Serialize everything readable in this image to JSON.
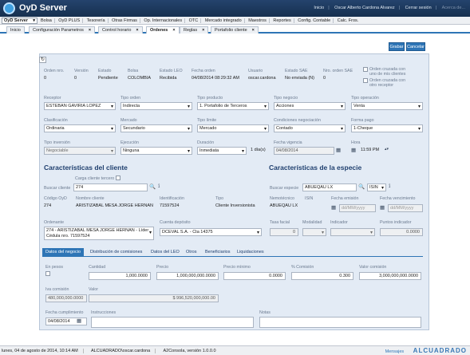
{
  "app": {
    "title": "OyD Server"
  },
  "user_links": [
    "Inicio",
    "Oscar Alberto Cardona Alvarez",
    "Cerrar sesión",
    "Acerca de..."
  ],
  "menu": {
    "selector": "OyD Server",
    "items": [
      "Bolsa",
      "OyD PLUS",
      "Tesorería",
      "Otras Firmas",
      "Op. Internacionales",
      "OTC",
      "Mercado integrado",
      "Maestros",
      "Reportes",
      "Config. Contable",
      "Calc. Fros."
    ]
  },
  "tabs": [
    {
      "label": "Inicio",
      "closable": false
    },
    {
      "label": "Configuración Parametros",
      "closable": true
    },
    {
      "label": "Control horario",
      "closable": true
    },
    {
      "label": "Ordenes",
      "closable": true,
      "active": true
    },
    {
      "label": "Reglas",
      "closable": true
    },
    {
      "label": "Portafolio cliente",
      "closable": true
    }
  ],
  "toolbar": {
    "save": "Grabar",
    "cancel": "Cancelar"
  },
  "summary": {
    "labels": {
      "orden_nro": "Orden nro.",
      "version": "Versión",
      "estado": "Estado",
      "bolsa": "Bolsa",
      "estado_leo": "Estado LEO",
      "fecha_orden": "Fecha orden",
      "usuario": "Usuario",
      "estado_sae": "Estado SAE",
      "nro_orden_sae": "Nro. orden SAE"
    },
    "values": {
      "orden_nro": "0",
      "version": "0",
      "estado": "Pendiente",
      "bolsa": "COLOMBIA",
      "estado_leo": "Recibida",
      "fecha_orden": "04/08/2014 08:29:32 AM",
      "usuario": "oscar.cardona",
      "estado_sae": "No enviada (N)",
      "nro_orden_sae": "0"
    },
    "check1": "Orden cruzada con uno de mis clientes",
    "check2": "Orden cruzada con otro receptor"
  },
  "form": {
    "receptor": {
      "label": "Receptor",
      "value": "ESTEBAN GAVIRIA LOPEZ"
    },
    "tipo_orden": {
      "label": "Tipo orden",
      "value": "Indirecta"
    },
    "tipo_producto": {
      "label": "Tipo producto",
      "value": "1. Portafolio de Terceros"
    },
    "tipo_negocio": {
      "label": "Tipo negocio",
      "value": "Acciones"
    },
    "tipo_operacion": {
      "label": "Tipo operación",
      "value": "Venta"
    },
    "clasificacion": {
      "label": "Clasificación",
      "value": "Ordinaria"
    },
    "mercado": {
      "label": "Mercado",
      "value": "Secundario"
    },
    "tipo_limite": {
      "label": "Tipo límite",
      "value": "Mercado"
    },
    "condiciones": {
      "label": "Condiciones negociación",
      "value": "Contado"
    },
    "forma_pago": {
      "label": "Forma pago",
      "value": "1-Cheque"
    },
    "tipo_inversion": {
      "label": "Tipo inversión",
      "value": "Negociable"
    },
    "ejecucion": {
      "label": "Ejecución",
      "value": "Ninguna"
    },
    "duracion": {
      "label": "Duración",
      "value": "Inmediata",
      "days": "1",
      "days_unit": "día(s)"
    },
    "fecha_vigencia": {
      "label": "Fecha vigencia",
      "value": "04/08/2014"
    },
    "hora": {
      "label": "Hora",
      "value": "11:59 PM"
    }
  },
  "cliente": {
    "title": "Características del cliente",
    "carga_tercero": "Carga cliente tercero",
    "buscar_label": "Buscar cliente",
    "buscar_value": "274",
    "labels": {
      "codigo": "Código OyD",
      "nombre": "Nombre cliente",
      "identificacion": "Identificación",
      "tipo": "Tipo"
    },
    "values": {
      "codigo": "274",
      "nombre": "ARISTIZABAL MESA JORGE HERNAN",
      "identificacion": "71597524",
      "tipo": "Cliente Inversionista"
    },
    "ordenante_label": "Ordenante",
    "ordenante_value": "274 - ARISTIZABAL MESA JORGE HERNAN - Líder Cédula nro. 71597524",
    "cuenta_label": "Cuenta depósito",
    "cuenta_value": "DCEVAL S.A. - Cta 14375"
  },
  "especie": {
    "title": "Características de la especie",
    "buscar_label": "Buscar especie",
    "buscar_value": "ABUEQAU LX",
    "isin_select": "ISIN",
    "labels": {
      "nemotecnico": "Nemotécnico",
      "isin": "ISIN",
      "fecha_emision": "Fecha emisión",
      "fecha_vencimiento": "Fecha vencimiento",
      "tasa_facial": "Tasa facial",
      "modalidad": "Modalidad",
      "indicador": "Indicador",
      "puntos_indicador": "Puntos indicador"
    },
    "values": {
      "nemotecnico": "ABUEQAU LX",
      "fecha_emision": "dd/MM/yyyy",
      "fecha_vencimiento": "dd/MM/yyyy",
      "tasa_facial": "0",
      "puntos_indicador": "0.0000"
    }
  },
  "subtabs": [
    "Datos del negocio",
    "Distribución de comisiones",
    "Datos del LEO",
    "Otros",
    "Beneficiarios",
    "Liquidaciones"
  ],
  "negocio": {
    "labels": {
      "en_pesos": "En pesos",
      "cantidad": "Cantidad",
      "precio": "Precio",
      "precio_minimo": "Precio mínimo",
      "pct_comision": "% Comisión",
      "valor_comision": "Valor comisión",
      "iva": "Iva comisión",
      "valor": "Valor",
      "fecha_cumplimiento": "Fecha cumplimiento",
      "instrucciones": "Instrucciones",
      "notas": "Notas"
    },
    "values": {
      "cantidad": "1,000.0000",
      "precio": "1,000,000,000.0000",
      "precio_minimo": "0.0000",
      "pct_comision": "0.300",
      "valor_comision": "3,000,000,000.0000",
      "iva": "480,000,000.0000",
      "valor": "$ 996,520,000,000.00",
      "fecha_cumplimiento": "04/08/2014"
    }
  },
  "status": {
    "items": [
      "lunes, 04 de agosto de 2014, 10:14 AM",
      "ALCUADRADO\\oscar.cardona",
      "A2Consola, versión 1.0.0.0"
    ],
    "messages": "Mensajes",
    "brand": "ALCUADRADO"
  }
}
